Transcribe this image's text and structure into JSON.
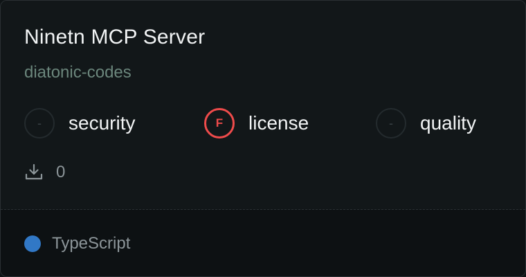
{
  "server": {
    "name": "Ninetn MCP Server",
    "org": "diatonic-codes"
  },
  "scores": [
    {
      "grade": "-",
      "label": "security",
      "icon": "score-empty-badge"
    },
    {
      "grade": "F",
      "label": "license",
      "icon": "grade-f-badge",
      "color": "#ef4b4b"
    },
    {
      "grade": "-",
      "label": "quality",
      "icon": "score-empty-badge"
    }
  ],
  "downloads": {
    "icon": "download-icon",
    "count": "0"
  },
  "language": {
    "name": "TypeScript",
    "color": "#3178c6"
  }
}
